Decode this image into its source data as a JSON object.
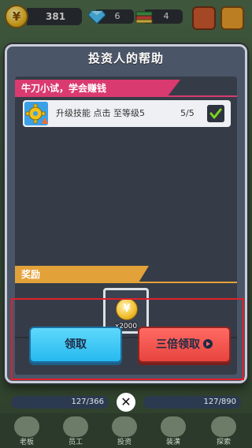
{
  "topbar": {
    "coin_symbol": "¥",
    "money": "381",
    "gems": "6",
    "books": "4"
  },
  "modal": {
    "title": "投资人的帮助",
    "task_section_label": "牛刀小试，学会赚钱",
    "task": {
      "text": "升级技能 点击 至等级5",
      "progress": "5/5",
      "completed": true
    },
    "reward_section_label": "奖励",
    "reward": {
      "symbol": "¥",
      "amount": "x2000"
    },
    "claim_button": "领取",
    "triple_button": "三倍领取"
  },
  "stats": {
    "left": "127/366",
    "right": "127/890"
  },
  "close_symbol": "✕",
  "bottom_nav": [
    {
      "label": "老板"
    },
    {
      "label": "员工"
    },
    {
      "label": "投资"
    },
    {
      "label": "装潢"
    },
    {
      "label": "探索"
    }
  ],
  "colors": {
    "claim_button": "#26b9ef",
    "triple_button": "#e8443f",
    "task_banner": "#d93a6f",
    "reward_banner": "#e3a13a",
    "highlight": "#e0202a"
  }
}
